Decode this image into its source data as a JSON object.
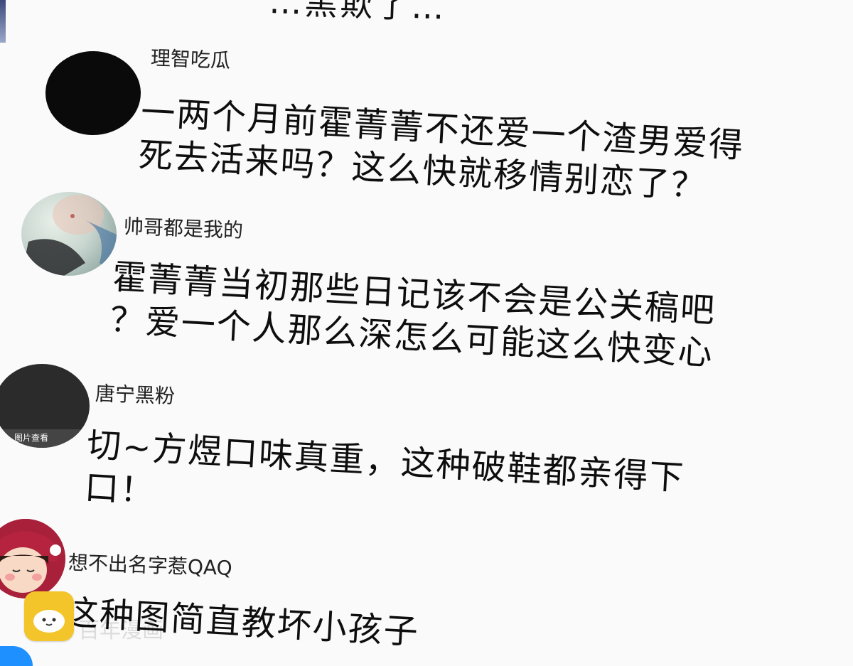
{
  "top_cut_text": "…黑欺了…",
  "comments": [
    {
      "username": "理智吃瓜",
      "avatar": "black-circle-avatar",
      "text": [
        "一两个月前霍菁菁不还爱一个渣男爱得",
        "死去活来吗？这么快就移情别恋了？"
      ]
    },
    {
      "username": "帅哥都是我的",
      "avatar": "illustrated-woman-avatar",
      "text": [
        "霍菁菁当初那些日记该不会是公关稿吧",
        "？爱一个人那么深怎么可能这么快变心"
      ]
    },
    {
      "username": "唐宁黑粉",
      "avatar": "dark-photo-avatar",
      "avatar_caption": "图片查看",
      "text": [
        "切~方煜口味真重，这种破鞋都亲得下",
        "口！"
      ]
    },
    {
      "username": "想不出名字惹QAQ",
      "avatar": "cartoon-girl-avatar",
      "text": [
        "这种图简直教坏小孩子"
      ]
    }
  ],
  "watermark": "百年漫画",
  "colors": {
    "text": "#111111",
    "logo_yellow": "#f4c52b",
    "corner_blue": "#1e90ff"
  }
}
